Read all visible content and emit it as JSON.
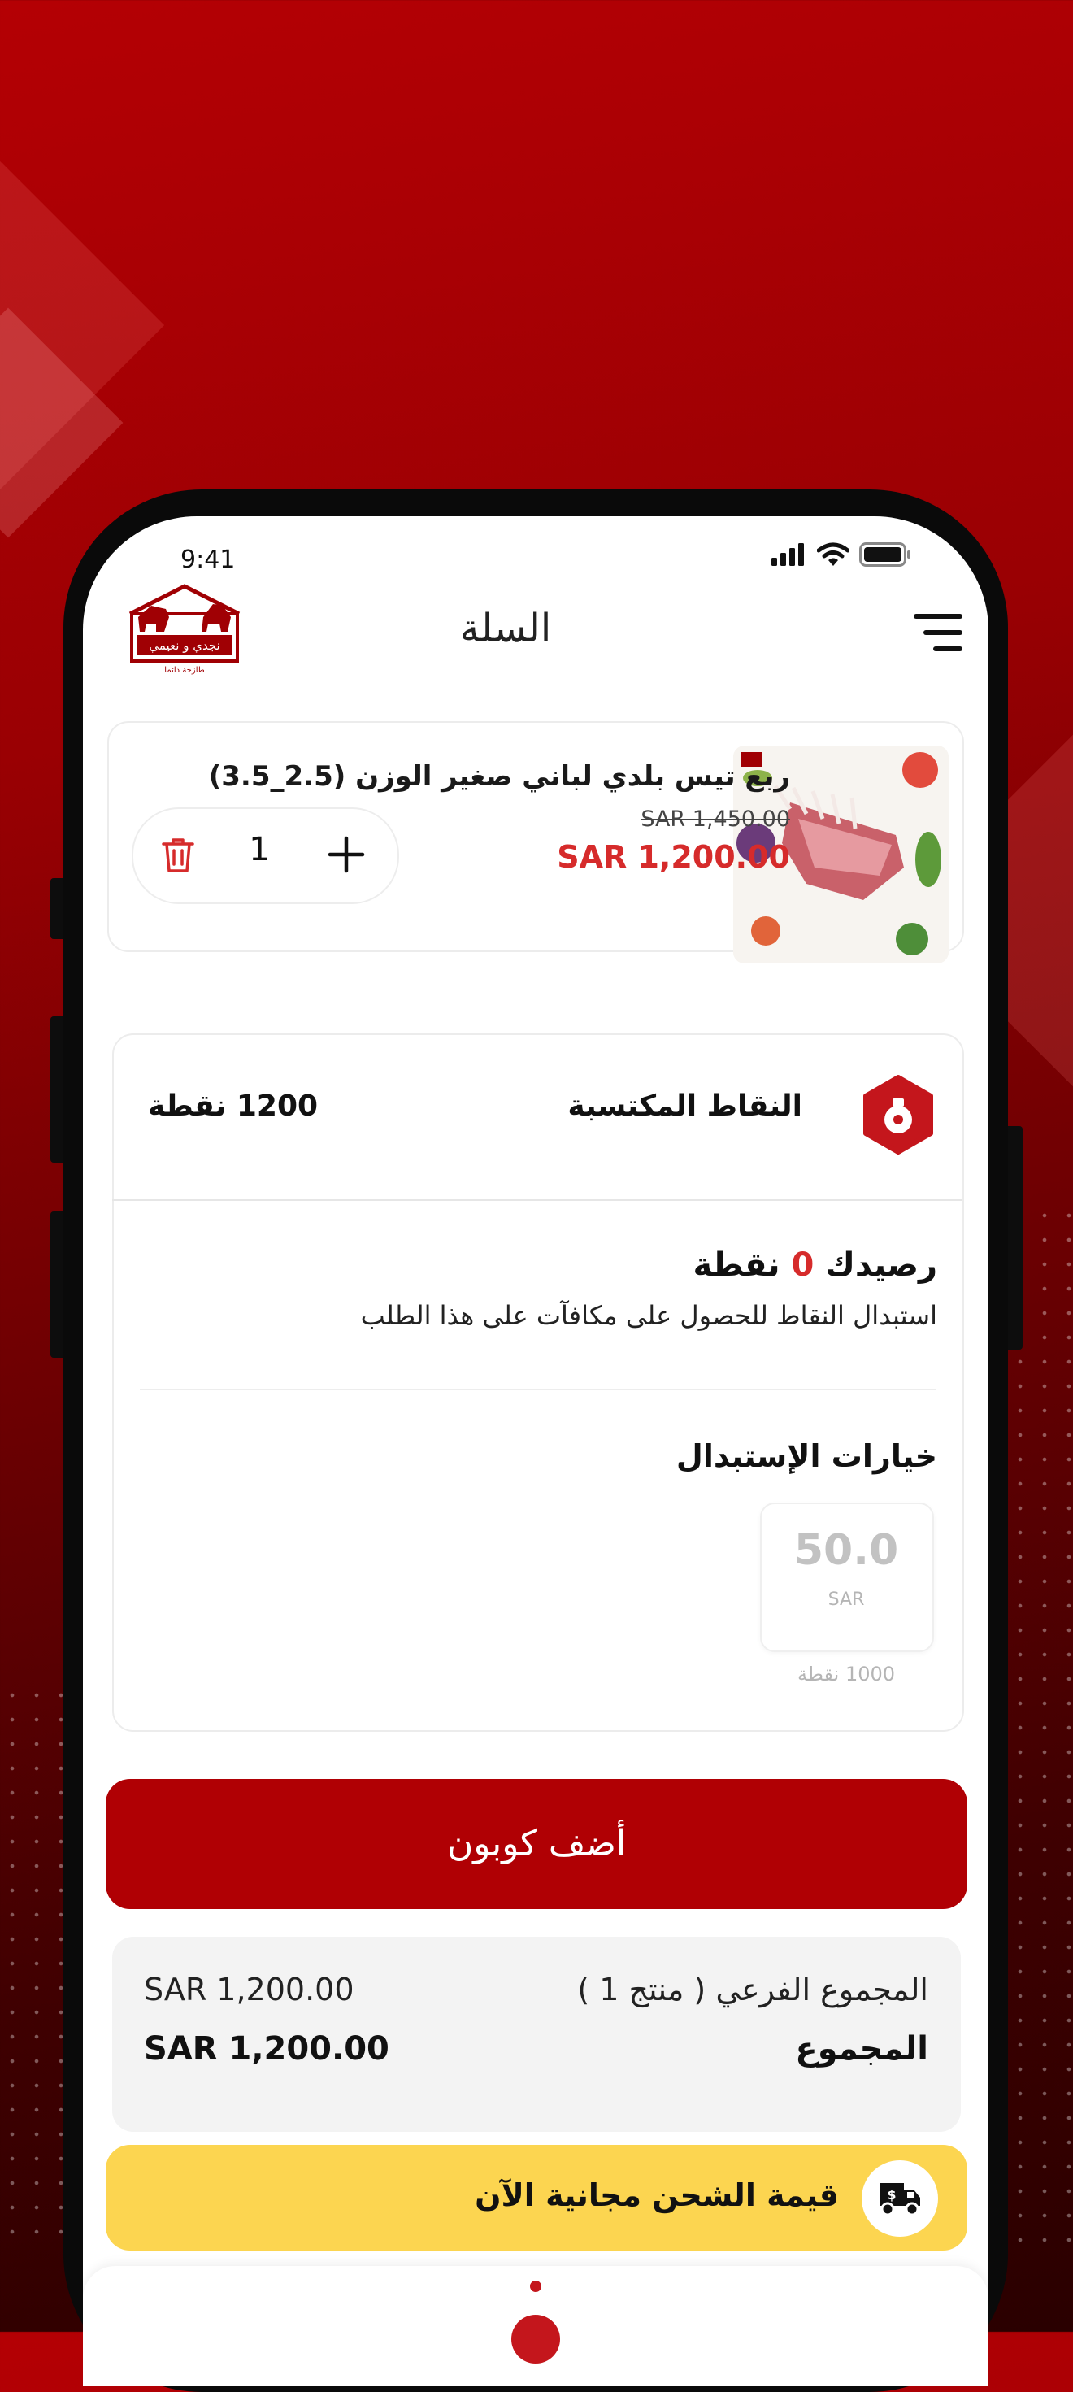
{
  "status_bar": {
    "time": "9:41"
  },
  "header": {
    "title": "السلة",
    "logo_text": "نجدي و نعيمي",
    "logo_tagline": "طازجة دائما"
  },
  "cart_item": {
    "name": "ربع تيس بلدي لباني صغير الوزن (2.5_3.5)",
    "old_price": "SAR 1,450.00",
    "price": "SAR 1,200.00",
    "quantity": "1"
  },
  "points": {
    "title": "النقاط المكتسبة",
    "value": "1200 نقطة",
    "balance_prefix": "رصيدك",
    "balance_value": "0",
    "balance_suffix": "نقطة",
    "description": "استبدال النقاط للحصول على مكافآت على هذا الطلب",
    "options_title": "خيارات الإستبدال",
    "option": {
      "amount": "50.0",
      "currency": "SAR",
      "points": "1000 نقطة"
    }
  },
  "coupon_button": "أضف كوبون",
  "totals": {
    "subtotal_label": "المجموع الفرعي ( منتج 1 )",
    "subtotal_value": "SAR 1,200.00",
    "total_label": "المجموع",
    "total_value": "SAR 1,200.00"
  },
  "shipping": {
    "text": "قيمة الشحن مجانية الآن"
  },
  "colors": {
    "brand_red": "#b00004",
    "price_red": "#d62b2b",
    "shipping_yellow": "#fcd550"
  },
  "icons": [
    "menu-icon",
    "trash-icon",
    "plus-icon",
    "points-badge-icon",
    "truck-icon",
    "signal-icon",
    "wifi-icon",
    "battery-icon"
  ]
}
